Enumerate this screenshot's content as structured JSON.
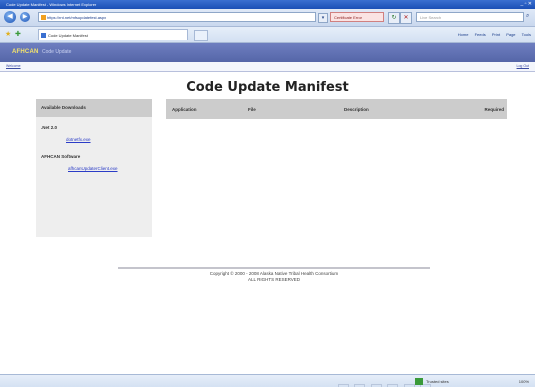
{
  "window": {
    "title": "Code Update Manifest - Windows Internet Explorer",
    "controls": "_ ▫ ✕"
  },
  "address_bar": {
    "url": "https://rnt.net/mfsupdatefest.aspx",
    "cert_label": "Certificate Error",
    "search_placeholder": "Live Search",
    "back_glyph": "◀",
    "forward_glyph": "▶"
  },
  "tabs": {
    "active_tab": "Code Update Manifest",
    "tools": [
      "Home",
      "Feeds",
      "Print",
      "Page",
      "Tools"
    ]
  },
  "app": {
    "brand": "AFHCAN",
    "brand_sub": "Code Update",
    "left_link": "Welcome",
    "right_link": "Log Out",
    "colors": {
      "header": "#5e6eb4",
      "brand": "#f5e46a",
      "link": "#2b3cc7"
    }
  },
  "page": {
    "title": "Code Update Manifest"
  },
  "downloads": {
    "header": "Available Downloads",
    "groups": [
      {
        "title": ".Net 2.0",
        "link": "dotnetfx.exe"
      },
      {
        "title": "AFHCAN Software",
        "link": "afhcanUpdaterClient.exe"
      }
    ]
  },
  "manifest_table": {
    "columns": [
      "Application",
      "File",
      "Description",
      "Required"
    ]
  },
  "footer": {
    "line1": "Copyright © 2000 - 2008 Alaska Native Tribal Health Consortium",
    "line2": "ALL RIGHTS RESERVED"
  },
  "status_bar": {
    "zone": "Trusted sites",
    "zoom": "100%"
  }
}
